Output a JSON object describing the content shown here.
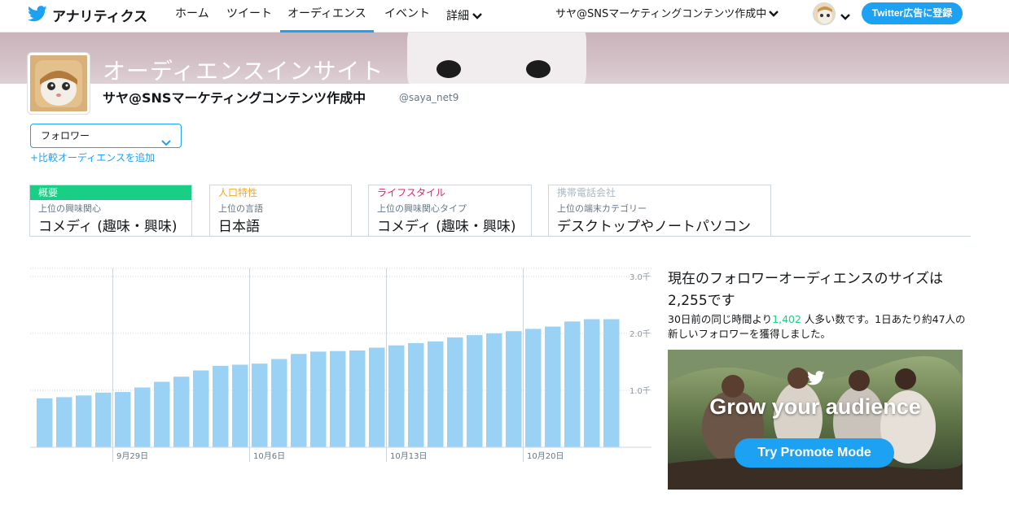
{
  "nav": {
    "app_title": "アナリティクス",
    "items": [
      {
        "label": "ホーム"
      },
      {
        "label": "ツイート"
      },
      {
        "label": "オーディエンス"
      },
      {
        "label": "イベント"
      },
      {
        "label": "詳細"
      }
    ],
    "active_index": 2,
    "user_name": "サヤ@SNSマーケティングコンテンツ作成中",
    "ads_button": "Twitter広告に登録"
  },
  "header": {
    "title": "オーディエンスインサイト",
    "profile_name": "サヤ@SNSマーケティングコンテンツ作成中",
    "profile_handle": "@saya_net9"
  },
  "audience": {
    "selected": "フォロワー",
    "add_compare": "+比較オーディエンスを追加"
  },
  "tabs": [
    {
      "category": "概要",
      "subtitle": "上位の興味関心",
      "value": "コメディ (趣味・興味)",
      "color": "#19cf86"
    },
    {
      "category": "人口特性",
      "subtitle": "上位の言語",
      "value": "日本語",
      "color": "#f5a623"
    },
    {
      "category": "ライフスタイル",
      "subtitle": "上位の興味関心タイプ",
      "value": "コメディ (趣味・興味)",
      "color": "#e0245e"
    },
    {
      "category": "携帯電話会社",
      "subtitle": "上位の端末カテゴリー",
      "value": "デスクトップやノートパソコン",
      "color": "#aab8c2"
    }
  ],
  "summary": {
    "line": "現在のフォロワーオーディエンスのサイズは 2,255です",
    "desc_before": "30日前の同じ時間より",
    "desc_number": "1,402",
    "desc_after": " 人多い数です。1日あたり約47人の新しいフォロワーを獲得しました。"
  },
  "promo": {
    "headline": "Grow your audience",
    "button": "Try Promote Mode"
  },
  "colors": {
    "accent": "#1da1f2",
    "bar": "#9ad2f6",
    "green": "#19cf86"
  },
  "chart_data": {
    "type": "bar",
    "unit": "千",
    "ylim": [
      0,
      3
    ],
    "yticks": [
      1.0,
      2.0,
      3.0
    ],
    "ytick_labels": [
      "1.0千",
      "2.0千",
      "3.0千"
    ],
    "grid": true,
    "xtick_labels": [
      {
        "index": 4,
        "label": "9月29日"
      },
      {
        "index": 11,
        "label": "10月6日"
      },
      {
        "index": 18,
        "label": "10月13日"
      },
      {
        "index": 25,
        "label": "10月20日"
      }
    ],
    "values": [
      0.86,
      0.88,
      0.91,
      0.96,
      0.97,
      1.05,
      1.15,
      1.24,
      1.35,
      1.43,
      1.45,
      1.47,
      1.55,
      1.64,
      1.68,
      1.69,
      1.7,
      1.75,
      1.79,
      1.83,
      1.86,
      1.93,
      1.97,
      2.0,
      2.04,
      2.08,
      2.12,
      2.21,
      2.25,
      2.25
    ]
  }
}
